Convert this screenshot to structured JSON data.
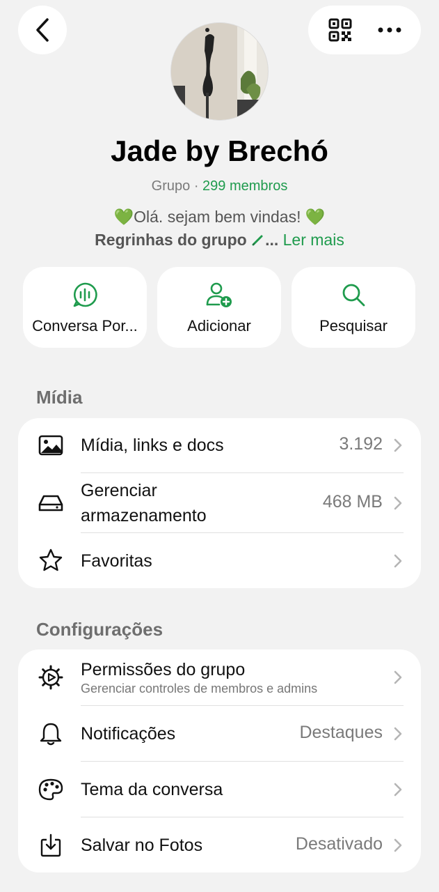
{
  "header": {
    "back_icon": "chevron-left-icon",
    "qr_icon": "qr-code-icon",
    "more_icon": "ellipsis-icon"
  },
  "group": {
    "name": "Jade by Brechó",
    "type": "Grupo",
    "separator": " · ",
    "members": "299 membros",
    "desc_heart": "💚",
    "desc_text": "Olá. sejam bem vindas! ",
    "rules_text": "Regrinhas do grupo",
    "rules_tail": "...",
    "read_more": "Ler mais"
  },
  "actions": [
    {
      "label": "Conversa Por...",
      "icon": "voice-chat-icon"
    },
    {
      "label": "Adicionar",
      "icon": "add-person-icon"
    },
    {
      "label": "Pesquisar",
      "icon": "search-icon"
    }
  ],
  "media_section": {
    "title": "Mídia",
    "items": [
      {
        "label": "Mídia, links e docs",
        "value": "3.192",
        "icon": "photo-icon"
      },
      {
        "label": "Gerenciar",
        "label2": "armazenamento",
        "value": "468 MB",
        "icon": "storage-icon"
      },
      {
        "label": "Favoritas",
        "value": "",
        "icon": "star-icon"
      }
    ]
  },
  "settings_section": {
    "title": "Configurações",
    "items": [
      {
        "label": "Permissões do grupo",
        "sub": "Gerenciar controles de membros e admins",
        "value": "",
        "icon": "gear-icon"
      },
      {
        "label": "Notificações",
        "value": "Destaques",
        "icon": "bell-icon"
      },
      {
        "label": "Tema da conversa",
        "value": "",
        "icon": "palette-icon"
      },
      {
        "label": "Salvar no Fotos",
        "value": "Desativado",
        "icon": "download-icon"
      }
    ]
  },
  "colors": {
    "accent": "#1f9b4d",
    "background": "#f2f2f2",
    "card": "#ffffff"
  }
}
